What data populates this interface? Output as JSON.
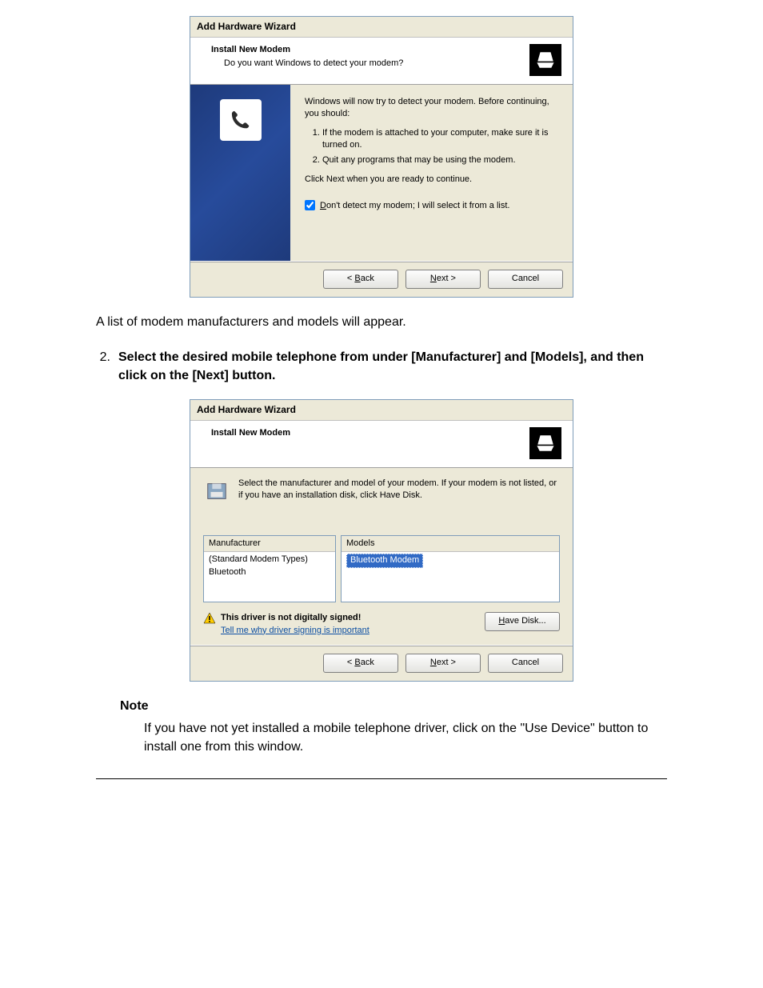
{
  "wizard1": {
    "title": "Add Hardware Wizard",
    "heading": "Install New Modem",
    "subheading": "Do you want Windows to detect your modem?",
    "intro": "Windows will now try to detect your modem. Before continuing, you should:",
    "step1": "If the modem is attached to your computer, make sure it is turned on.",
    "step2": "Quit any programs that may be using the modem.",
    "continue_line": "Click Next when you are ready to continue.",
    "checkbox": {
      "checked": true,
      "pre": "D",
      "rest": "on't detect my modem; I will select it from a list."
    },
    "buttons": {
      "back_pre": "< ",
      "back_u": "B",
      "back_rest": "ack",
      "next_u": "N",
      "next_rest": "ext >",
      "cancel": "Cancel"
    }
  },
  "caption1": "A list of modem manufacturers and models will appear.",
  "step_num": "2.",
  "step_text": "Select the desired mobile telephone from under [Manufacturer] and [Models], and then click on the [Next] button.",
  "wizard2": {
    "title": "Add Hardware Wizard",
    "heading": "Install New Modem",
    "intro": "Select the manufacturer and model of your modem. If your modem is not listed, or if you have an installation disk, click Have Disk.",
    "col1_header": "Manufacturer",
    "col1_items": [
      "(Standard Modem Types)",
      "Bluetooth"
    ],
    "col2_header": "Models",
    "col2_selected": "Bluetooth Modem",
    "warning": "This driver is not digitally signed!",
    "link": "Tell me why driver signing is important",
    "have_disk_u": "H",
    "have_disk_rest": "ave Disk...",
    "buttons": {
      "back_pre": "< ",
      "back_u": "B",
      "back_rest": "ack",
      "next_u": "N",
      "next_rest": "ext >",
      "cancel": "Cancel"
    }
  },
  "note_heading": "Note",
  "note_text": "If you have not yet installed a mobile telephone driver, click on the \"Use Device\" button to install one from this window."
}
